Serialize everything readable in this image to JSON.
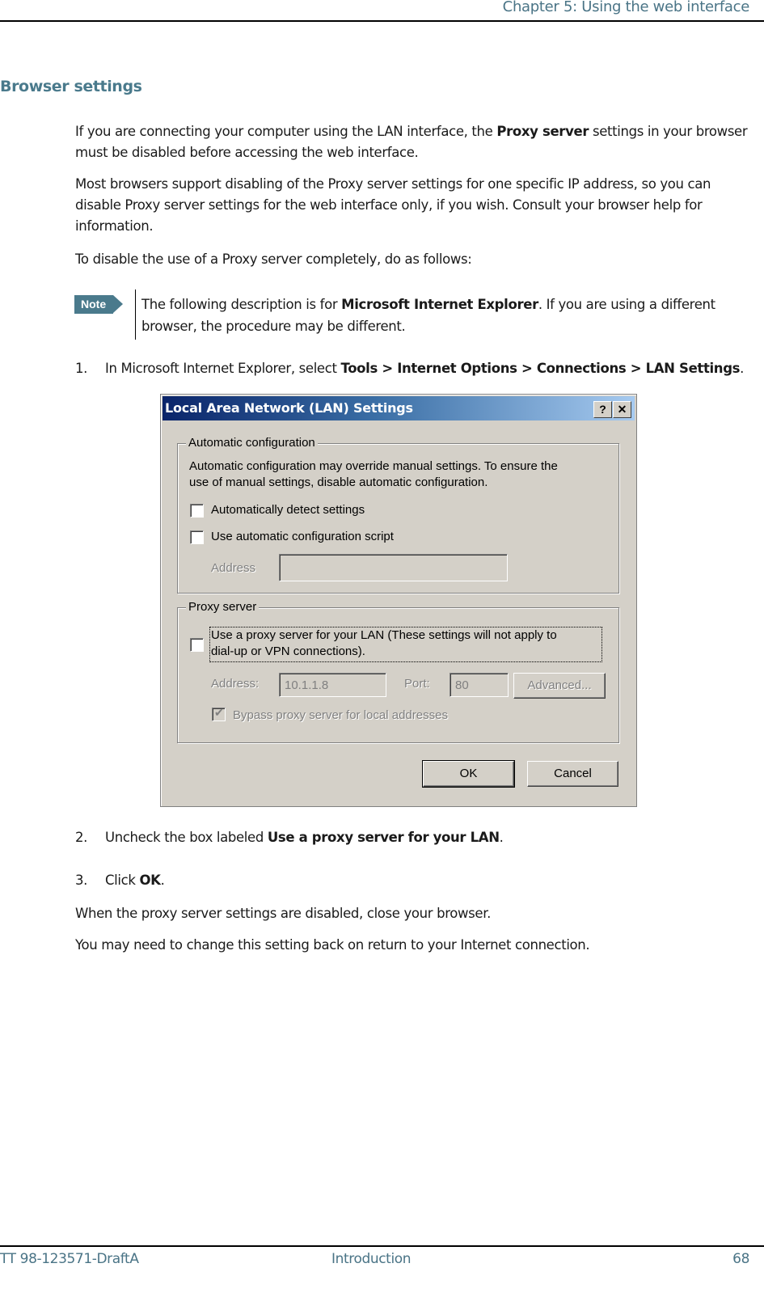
{
  "header": {
    "chapter": "Chapter 5: Using the web interface"
  },
  "section": {
    "title": "Browser settings"
  },
  "paragraphs": {
    "p1_pre": "If you are connecting your computer using the LAN interface, the ",
    "p1_bold": "Proxy server",
    "p1_post": " settings in your browser must be disabled before accessing the web interface.",
    "p2": "Most browsers support disabling of the Proxy server settings for one specific IP address, so you can disable Proxy server settings for the web interface only, if you wish. Consult your browser help for information.",
    "p3": "To disable the use of a Proxy server completely, do as follows:"
  },
  "note": {
    "tag": "Note",
    "pre": "The following description is for ",
    "bold": "Microsoft Internet Explorer",
    "post": ". If you are using a different browser, the procedure may be different."
  },
  "steps": [
    {
      "num": "1.",
      "pre": "In Microsoft Internet Explorer, select ",
      "bold": "Tools > Internet Options > Connections > LAN Settings",
      "post": "."
    },
    {
      "num": "2.",
      "pre": "Uncheck the box labeled ",
      "bold": "Use a proxy server for your LAN",
      "post": "."
    },
    {
      "num": "3.",
      "pre": "Click ",
      "bold": "OK",
      "post": "."
    }
  ],
  "after": {
    "p4": "When the proxy server settings are disabled, close your browser.",
    "p5": "You may need to change this setting back on return to your Internet connection."
  },
  "dialog": {
    "title": "Local Area Network (LAN) Settings",
    "help_btn": "?",
    "close_btn": "✕",
    "auto_group": {
      "legend": "Automatic configuration",
      "desc_line1": "Automatic configuration may override manual settings.  To ensure the",
      "desc_line2": "use of manual settings, disable automatic configuration.",
      "detect_label": "Automatically detect settings",
      "detect_checked": false,
      "script_label": "Use automatic configuration script",
      "script_checked": false,
      "address_label": "Address",
      "address_value": ""
    },
    "proxy_group": {
      "legend": "Proxy server",
      "use_proxy_line1": "Use a proxy server for your LAN (These settings will not apply to",
      "use_proxy_line2": "dial-up or VPN connections).",
      "use_proxy_checked": false,
      "address_label": "Address:",
      "address_value": "10.1.1.8",
      "port_label": "Port:",
      "port_value": "80",
      "advanced_label": "Advanced...",
      "bypass_label": "Bypass proxy server for local addresses",
      "bypass_checked": true
    },
    "ok_label": "OK",
    "cancel_label": "Cancel"
  },
  "footer": {
    "doc_id": "TT 98-123571-DraftA",
    "section": "Introduction",
    "page": "68"
  }
}
